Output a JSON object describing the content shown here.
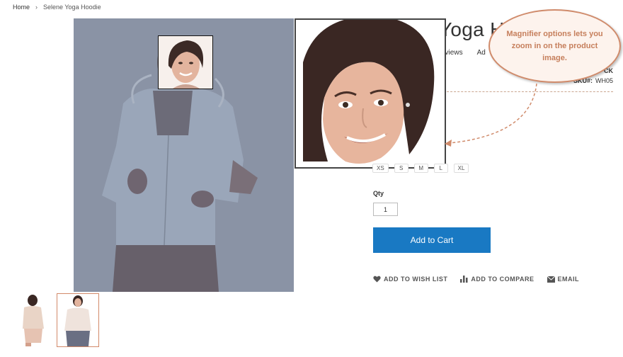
{
  "breadcrumb": {
    "home": "Home",
    "separator": "›",
    "current": "Selene Yoga Hoodie"
  },
  "product": {
    "title_visible": "Yoga H",
    "reviews_link": "eviews",
    "add_review_link": "Ad",
    "stock_visible": "CK",
    "sku_label": "SKU#:",
    "sku_value": "WH05"
  },
  "sizes": [
    "XS",
    "S",
    "M",
    "L",
    "XL"
  ],
  "qty": {
    "label": "Qty",
    "value": "1"
  },
  "add_to_cart_label": "Add to Cart",
  "actions": {
    "wishlist": "ADD TO WISH LIST",
    "compare": "ADD TO COMPARE",
    "email": "EMAIL"
  },
  "callout": {
    "text": "Magnifier options lets you zoom in on the product image."
  },
  "colors": {
    "accent": "#1979c3",
    "callout_text": "#c67f5c",
    "callout_border": "#d08b6b"
  }
}
